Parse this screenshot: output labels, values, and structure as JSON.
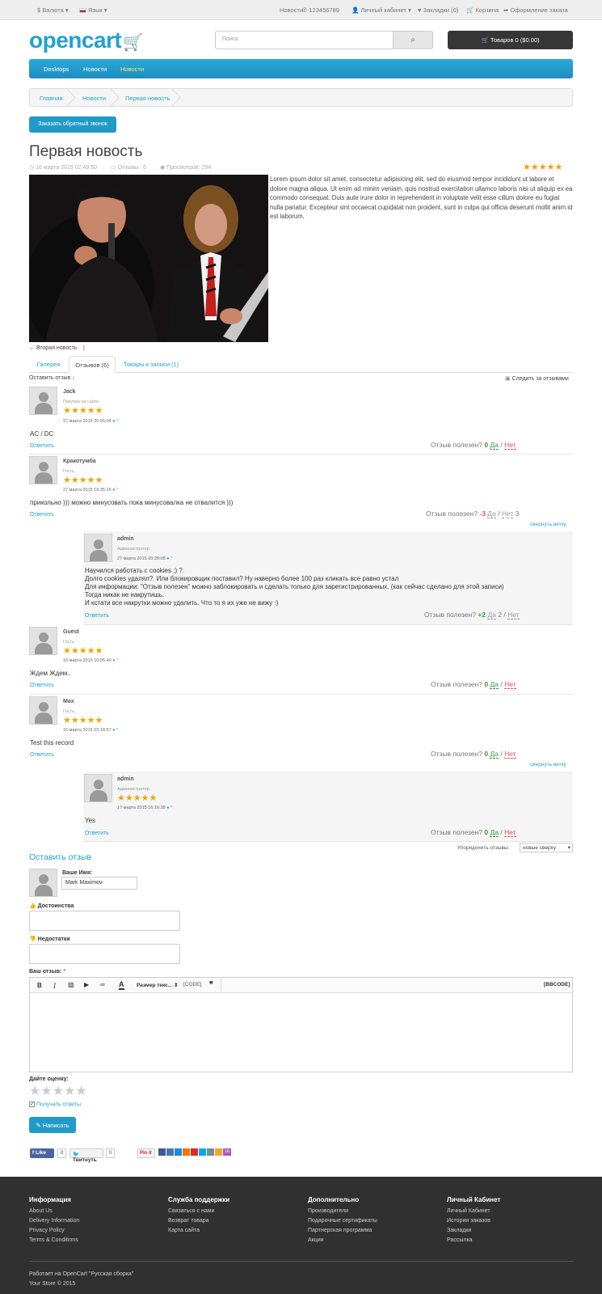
{
  "topbar": {
    "currency": "$ Валюта ▾",
    "language": "Язык ▾",
    "news": "Новости",
    "phone": "123456789",
    "account": "Личный кабинет ▾",
    "wishlist": "Закладки (0)",
    "cart": "Корзина",
    "checkout": "Оформление заказа"
  },
  "header": {
    "logo": "opencart",
    "search_placeholder": "Поиск",
    "cart_button": "Товаров 0 ($0.00)"
  },
  "menu": [
    "Desktops",
    "Новости",
    "Новости"
  ],
  "breadcrumb": [
    "Главная",
    "Новости",
    "Первая новость"
  ],
  "callback_button": "Заказать обратный звонок",
  "article": {
    "title": "Первая новость",
    "date": "16 марта 2015 02:49:50",
    "reviews_count": "Отзывы : 6",
    "views": "Просмотров: 294",
    "rating": 5,
    "stars": "★★★★★",
    "body": "Lorem ipsum dolor sit amet, consectetur adipisicing elit, sed do eiusmod tempor incididunt ut labore et dolore magna aliqua. Ut enim ad minim veniam, quis nostrud exercitation ullamco laboris nisi ut aliquip ex ea commodo consequat. Duis aute irure dolor in reprehenderit in voluptate velit esse cillum dolore eu fugiat nulla pariatur. Excepteur sint occaecat cupidatat non proident, sunt in culpa qui officia deserunt mollit anim id est laborum.",
    "prev_link": "← Вторая новость",
    "sep": "|"
  },
  "tabs": [
    "Галерея",
    "Отзывов (6)",
    "Товары к записи (1)"
  ],
  "reviews_header": {
    "leave": "Оставить отзыв ↓",
    "subscribe": "Следить за отзывами"
  },
  "reviews": [
    {
      "name": "Jack",
      "role": "Покупка на сайте.",
      "stars": "★★★★★",
      "date": "27 марта 2015 20:55:04",
      "text": "AC / DC",
      "reply": "Ответить",
      "useful_label": "Отзыв полезен?",
      "score": "0",
      "yes": "Да",
      "slash": "/",
      "no": "Нет",
      "no_count": ""
    },
    {
      "name": "Кракотумба",
      "role": "Гость.",
      "stars": "★★★★★",
      "date": "27 марта 2015 19:35:16",
      "text": "прикольно ))) можно минусовать пока минусовалка не отвалится )))",
      "reply": "Ответить",
      "useful_label": "Отзыв полезен?",
      "score": "-3",
      "yes": "Да",
      "slash": "/",
      "no": "Нет",
      "no_count": "3",
      "collapse": "свернуть ветку"
    },
    {
      "name": "admin",
      "role": "Администратор.",
      "date": "27 марта 2015 20:28:08",
      "text_lines": [
        "Научился работать с cookies ;) ?.",
        "Долго cookies удалял?.  Или блокировщик поставил? Ну наверно более 100 раз кликать все равно устал",
        "Для информации: \"Отзыв полезен\" можно заблокировать и сделать только для зарегистрированных. (как сейчас сделано для этой записи)",
        "Тогда никак не накрутишь.",
        "И кстати все накрутки можно удалить. Что то я их уже не вижу :)"
      ],
      "reply": "Ответить",
      "useful_label": "Отзыв полезен?",
      "score": "+2",
      "yes": "Да",
      "yes_count": "2",
      "slash": "/",
      "no": "Нет"
    },
    {
      "name": "Guest",
      "role": "Гость.",
      "stars": "★★★★★",
      "date": "16 марта 2015 10:05:49",
      "text": "Ждем Ждем..",
      "reply": "Ответить",
      "useful_label": "Отзыв полезен?",
      "score": "0",
      "yes": "Да",
      "slash": "/",
      "no": "Нет"
    },
    {
      "name": "Max",
      "role": "Гость.",
      "stars": "★★★★★",
      "date": "16 марта 2015 03:18:57",
      "text": "Test this record",
      "reply": "Ответить",
      "useful_label": "Отзыв полезен?",
      "score": "0",
      "yes": "Да",
      "slash": "/",
      "no": "Нет",
      "collapse": "свернуть ветку"
    },
    {
      "name": "admin",
      "role": "Администратор.",
      "stars": "★★★★★",
      "date": "17 марта 2015 16:16:38",
      "text": "Yes",
      "reply": "Ответить",
      "useful_label": "Отзыв полезен?",
      "score": "0",
      "yes": "Да",
      "slash": "/",
      "no": "Нет"
    }
  ],
  "sort": {
    "label": "Упорядочить отзывы:",
    "value": "новые сверху"
  },
  "form": {
    "title": "Оставить отзыв",
    "name_label": "Ваше Имя:",
    "name_value": "Mark Maximov",
    "pros_label": "Достоинства",
    "cons_label": "Недостатки",
    "review_label": "Ваш отзыв:",
    "required": "*",
    "toolbar": {
      "bold": "B",
      "italic": "I",
      "color": "A",
      "size": "Размер текс... ⇕",
      "code": "[CODE]",
      "quote": "❞",
      "bbcode": "[BBCODE]"
    },
    "rate_label": "Дайте оценку:",
    "rate_stars": "★★★★★",
    "get_answers": "Получать ответы",
    "submit": "Написать"
  },
  "social": {
    "fb": "Like",
    "fb_count": "0",
    "tw": "Твитнуть",
    "tw_count": "0",
    "pin": "Pin it",
    "plus_count": "16"
  },
  "footer": {
    "cols": [
      {
        "title": "Информация",
        "links": [
          "About Us",
          "Delivery Information",
          "Privacy Policy",
          "Terms & Conditions"
        ]
      },
      {
        "title": "Служба поддержки",
        "links": [
          "Связаться с нами",
          "Возврат товара",
          "Карта сайта"
        ]
      },
      {
        "title": "Дополнительно",
        "links": [
          "Производители",
          "Подарочные сертификаты",
          "Партнерская программа",
          "Акции"
        ]
      },
      {
        "title": "Личный Кабинет",
        "links": [
          "Личный Кабинет",
          "История заказов",
          "Закладки",
          "Рассылка"
        ]
      }
    ],
    "powered": "Работает на OpenCart \"Русская сборка\"",
    "copyright": "Your Store © 2015"
  },
  "colors": {
    "accent": "#23a1d1",
    "menu": "#229ac8",
    "star": "#f0a400",
    "footer": "#303030"
  }
}
